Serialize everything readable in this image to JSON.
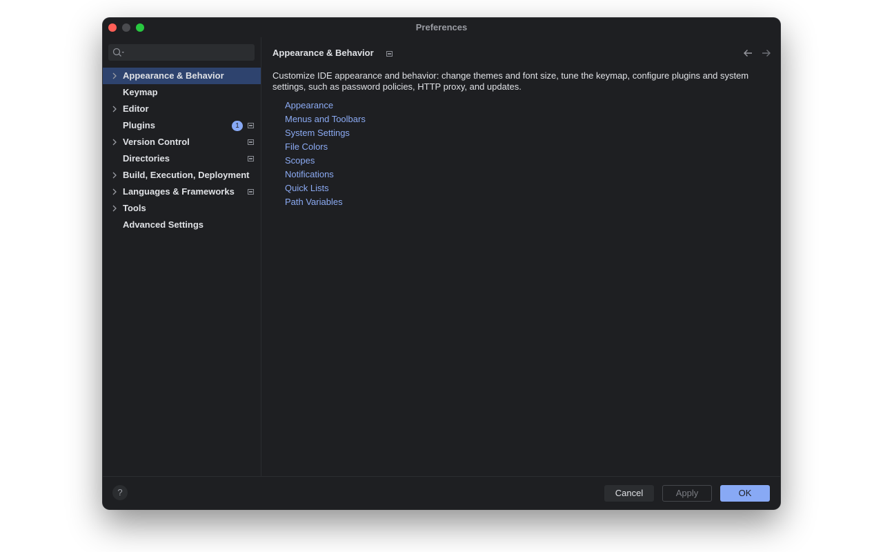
{
  "window": {
    "title": "Preferences"
  },
  "search": {
    "placeholder": "",
    "value": ""
  },
  "sidebar": {
    "items": [
      {
        "label": "Appearance & Behavior",
        "expandable": true,
        "selected": true
      },
      {
        "label": "Keymap",
        "expandable": false
      },
      {
        "label": "Editor",
        "expandable": true
      },
      {
        "label": "Plugins",
        "expandable": false,
        "badge": "1",
        "project_icon": true
      },
      {
        "label": "Version Control",
        "expandable": true,
        "project_icon": true
      },
      {
        "label": "Directories",
        "expandable": false,
        "project_icon": true
      },
      {
        "label": "Build, Execution, Deployment",
        "expandable": true
      },
      {
        "label": "Languages & Frameworks",
        "expandable": true,
        "project_icon": true
      },
      {
        "label": "Tools",
        "expandable": true
      },
      {
        "label": "Advanced Settings",
        "expandable": false
      }
    ]
  },
  "content": {
    "header": "Appearance & Behavior",
    "description": "Customize IDE appearance and behavior: change themes and font size, tune the keymap, configure plugins and system settings, such as password policies, HTTP proxy, and updates.",
    "links": [
      "Appearance",
      "Menus and Toolbars",
      "System Settings",
      "File Colors",
      "Scopes",
      "Notifications",
      "Quick Lists",
      "Path Variables"
    ]
  },
  "footer": {
    "help_label": "?",
    "cancel_label": "Cancel",
    "apply_label": "Apply",
    "ok_label": "OK"
  },
  "colors": {
    "background": "#1e1f22",
    "selection": "#2e436e",
    "link": "#8cabf4",
    "accent": "#88a9f5",
    "text": "#dfe1e5"
  }
}
